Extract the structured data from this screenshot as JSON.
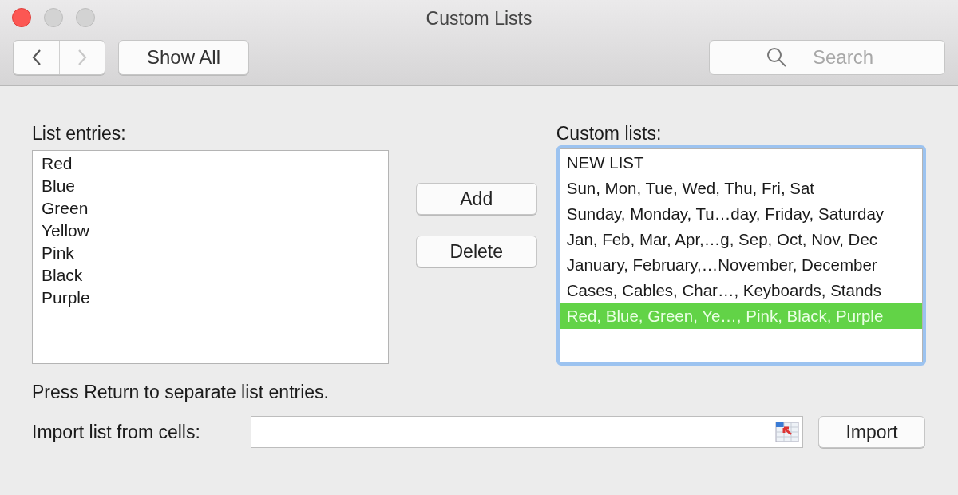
{
  "window": {
    "title": "Custom Lists"
  },
  "toolbar": {
    "nav_buttons": [
      {
        "kind": "back",
        "disabled": false
      },
      {
        "kind": "forward",
        "disabled": true
      }
    ],
    "show_all": "Show All",
    "search": {
      "placeholder": "Search"
    }
  },
  "list_entries": {
    "label": "List entries:",
    "lines": [
      "Red",
      "Blue",
      "Green",
      "Yellow",
      "Pink",
      "Black",
      "Purple"
    ]
  },
  "actions": [
    "Add",
    "Delete"
  ],
  "custom_lists": {
    "label": "Custom lists:",
    "items": [
      {
        "text": "NEW LIST",
        "selected": false
      },
      {
        "text": "Sun, Mon, Tue, Wed, Thu, Fri, Sat",
        "selected": false
      },
      {
        "text": "Sunday, Monday, Tu…day, Friday, Saturday",
        "selected": false
      },
      {
        "text": "Jan, Feb, Mar, Apr,…g, Sep, Oct, Nov, Dec",
        "selected": false
      },
      {
        "text": "January, February,…November, December",
        "selected": false
      },
      {
        "text": "Cases, Cables, Char…, Keyboards, Stands",
        "selected": false
      },
      {
        "text": "Red, Blue, Green, Ye…, Pink, Black, Purple",
        "selected": true
      }
    ]
  },
  "hint": "Press Return to separate list entries.",
  "import": {
    "label": "Import list from cells:",
    "button": "Import"
  }
}
